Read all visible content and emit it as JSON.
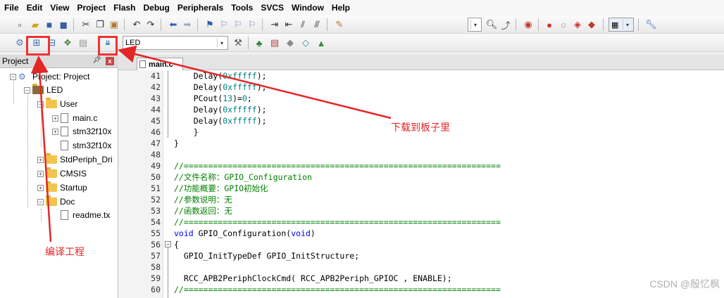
{
  "menu": [
    "File",
    "Edit",
    "View",
    "Project",
    "Flash",
    "Debug",
    "Peripherals",
    "Tools",
    "SVCS",
    "Window",
    "Help"
  ],
  "toolbar2": {
    "target_value": "LED"
  },
  "project_panel": {
    "title": "Project",
    "pin_icon": "pin-icon",
    "close_label": "x",
    "tree": [
      {
        "label": "Project: Project",
        "kind": "root"
      },
      {
        "label": "LED",
        "kind": "target"
      },
      {
        "label": "User",
        "kind": "folder"
      },
      {
        "label": "main.c",
        "kind": "file"
      },
      {
        "label": "stm32f10x",
        "kind": "file"
      },
      {
        "label": "stm32f10x",
        "kind": "file"
      },
      {
        "label": "StdPeriph_Dri",
        "kind": "folder"
      },
      {
        "label": "CMSIS",
        "kind": "folder"
      },
      {
        "label": "Startup",
        "kind": "folder"
      },
      {
        "label": "Doc",
        "kind": "folder"
      },
      {
        "label": "readme.tx",
        "kind": "file"
      }
    ]
  },
  "editor": {
    "tab_label": "main.c",
    "lines": [
      {
        "n": "41",
        "text": "    Delay(0xfffff);"
      },
      {
        "n": "42",
        "text": "    Delay(0xfffff);"
      },
      {
        "n": "43",
        "text": "    PCout(13)=0;"
      },
      {
        "n": "44",
        "text": "    Delay(0xfffff);"
      },
      {
        "n": "45",
        "text": "    Delay(0xfffff);"
      },
      {
        "n": "46",
        "text": "    }"
      },
      {
        "n": "47",
        "text": "}"
      },
      {
        "n": "48",
        "text": ""
      },
      {
        "n": "49",
        "text": "//================================================================="
      },
      {
        "n": "50",
        "text": "//文件名称：GPIO_Configuration"
      },
      {
        "n": "51",
        "text": "//功能概要：GPIO初始化"
      },
      {
        "n": "52",
        "text": "//参数说明：无"
      },
      {
        "n": "53",
        "text": "//函数返回：无"
      },
      {
        "n": "54",
        "text": "//================================================================="
      },
      {
        "n": "55",
        "text": "void GPIO_Configuration(void)"
      },
      {
        "n": "56",
        "text": "{"
      },
      {
        "n": "57",
        "text": "  GPIO_InitTypeDef GPIO_InitStructure;"
      },
      {
        "n": "58",
        "text": ""
      },
      {
        "n": "59",
        "text": "  RCC_APB2PeriphClockCmd( RCC_APB2Periph_GPIOC , ENABLE);"
      },
      {
        "n": "60",
        "text": "//================================================================="
      }
    ]
  },
  "annotations": {
    "compile_label": "编译工程",
    "download_label": "下载到板子里",
    "color": "#e32626"
  },
  "watermark": "CSDN @殷忆枫",
  "colors": {
    "comment": "#008000",
    "number": "#008080",
    "keyword": "#0000ff"
  }
}
